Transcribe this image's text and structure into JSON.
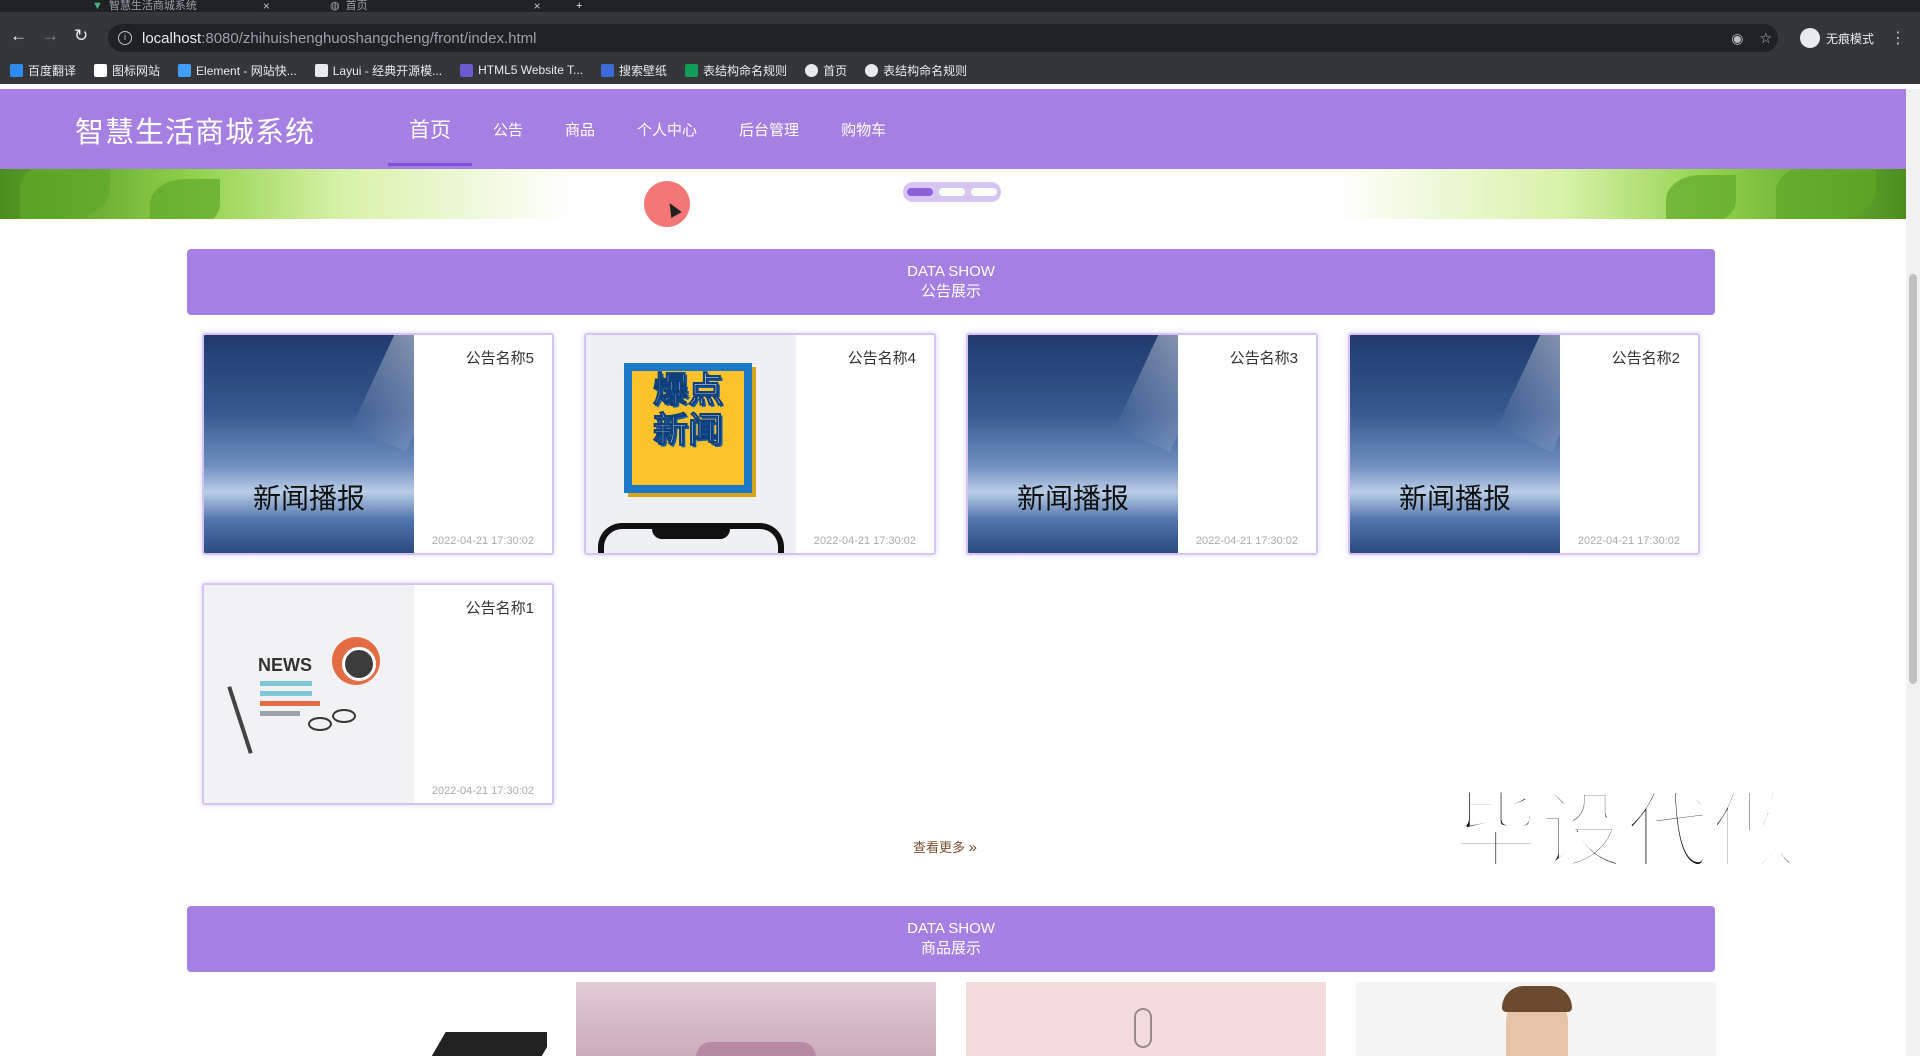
{
  "browser": {
    "tabs": [
      {
        "title": "智慧生活商城系统"
      },
      {
        "title": "首页"
      }
    ],
    "url_host": "localhost",
    "url_path": ":8080/zhihuishenghuoshangcheng/front/index.html",
    "profile_label": "无痕模式",
    "bookmarks": [
      {
        "label": "百度翻译",
        "color": "#2e8cf0"
      },
      {
        "label": "图标网站",
        "color": "#ffffff"
      },
      {
        "label": "Element - 网站快...",
        "color": "#409eff"
      },
      {
        "label": "Layui - 经典开源模...",
        "color": "#e8eaed"
      },
      {
        "label": "HTML5 Website T...",
        "color": "#6a5acd"
      },
      {
        "label": "搜索壁纸",
        "color": "#3b6bd6"
      },
      {
        "label": "表结构命名规则",
        "color": "#0f9d58"
      },
      {
        "label": "首页",
        "color": "#e8eaed"
      },
      {
        "label": "表结构命名规则",
        "color": "#e8eaed"
      }
    ]
  },
  "site": {
    "logo": "智慧生活商城系统",
    "nav": [
      "首页",
      "公告",
      "商品",
      "个人中心",
      "后台管理",
      "购物车"
    ],
    "accent": "#a57fe1"
  },
  "notice_section": {
    "en": "DATA SHOW",
    "zh": "公告展示",
    "cards": [
      {
        "title": "公告名称5",
        "time": "2022-04-21 17:30:02",
        "thumb_text": "新闻播报",
        "thumb": "sky"
      },
      {
        "title": "公告名称4",
        "time": "2022-04-21 17:30:02",
        "thumb_text": "爆点新闻",
        "thumb": "burst"
      },
      {
        "title": "公告名称3",
        "time": "2022-04-21 17:30:02",
        "thumb_text": "新闻播报",
        "thumb": "sky"
      },
      {
        "title": "公告名称2",
        "time": "2022-04-21 17:30:02",
        "thumb_text": "新闻播报",
        "thumb": "sky"
      },
      {
        "title": "公告名称1",
        "time": "2022-04-21 17:30:02",
        "thumb_text": "NEWS",
        "thumb": "news"
      }
    ],
    "more": "查看更多"
  },
  "goods_section": {
    "en": "DATA SHOW",
    "zh": "商品展示"
  },
  "overlay_watermark": "毕设代做"
}
